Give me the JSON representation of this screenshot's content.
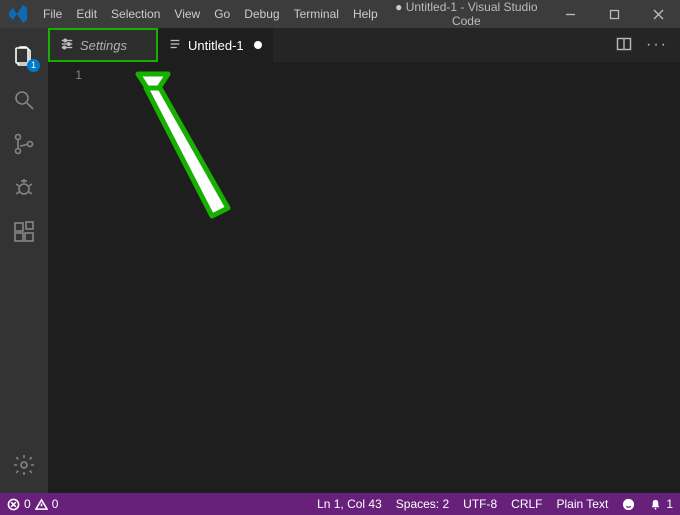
{
  "menu": {
    "file": "File",
    "edit": "Edit",
    "selection": "Selection",
    "view": "View",
    "go": "Go",
    "debug": "Debug",
    "terminal": "Terminal",
    "help": "Help"
  },
  "title": {
    "filename": "Untitled-1",
    "app": "Visual Studio Code"
  },
  "activity": {
    "explorer_badge": "1"
  },
  "tabs": {
    "settings": "Settings",
    "untitled": "Untitled-1"
  },
  "editor": {
    "line1": "1"
  },
  "status": {
    "errors": "0",
    "warnings": "0",
    "cursor": "Ln 1, Col 43",
    "spaces": "Spaces: 2",
    "encoding": "UTF-8",
    "eol": "CRLF",
    "language": "Plain Text",
    "notifications": "1"
  }
}
